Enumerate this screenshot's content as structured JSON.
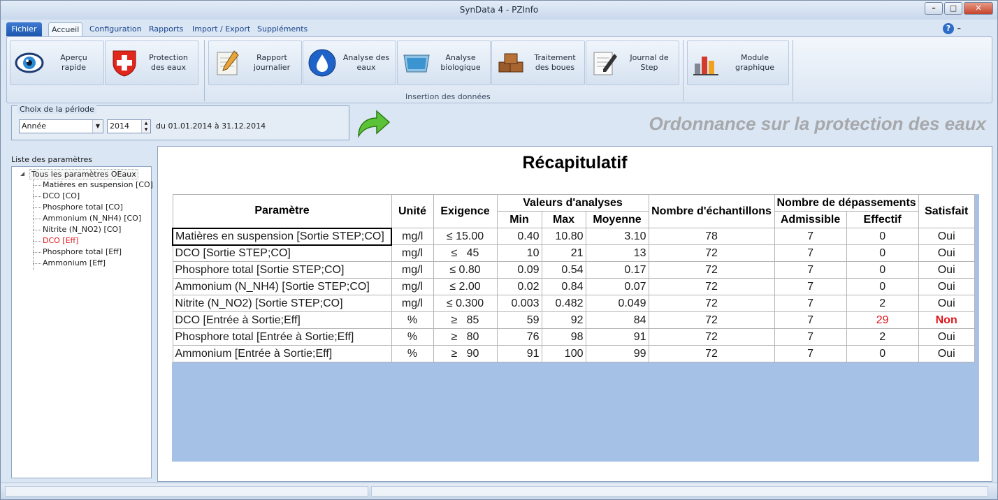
{
  "window": {
    "title": "SynData 4 - PZInfo"
  },
  "tabs": {
    "fichier": "Fichier",
    "accueil": "Accueil",
    "configuration": "Configuration",
    "rapports": "Rapports",
    "import_export": "Import / Export",
    "supplements": "Suppléments"
  },
  "help_label": "?",
  "ribbon": {
    "apercu": "Aperçu rapide",
    "protection": "Protection des eaux",
    "rapport": "Rapport journalier",
    "analyse_eaux": "Analyse des eaux",
    "analyse_bio": "Analyse biologique",
    "traitement": "Traitement des boues",
    "journal": "Journal de Step",
    "module": "Module graphique",
    "group_insertion": "Insertion des données"
  },
  "period": {
    "legend": "Choix de la période",
    "type": "Année",
    "year": "2014",
    "range": "du 01.01.2014 à 31.12.2014"
  },
  "banner": "Ordonnance sur la protection des eaux",
  "sidebar": {
    "title": "Liste des paramètres",
    "root": "Tous les paramètres OEaux",
    "items": [
      "Matières en suspension [CO]",
      "DCO [CO]",
      "Phosphore total [CO]",
      "Ammonium (N_NH4) [CO]",
      "Nitrite (N_NO2) [CO]",
      "DCO [Eff]",
      "Phosphore total [Eff]",
      "Ammonium [Eff]"
    ]
  },
  "recap": {
    "title": "Récapitulatif",
    "headers": {
      "parametre": "Paramètre",
      "unite": "Unité",
      "exigence": "Exigence",
      "valeurs": "Valeurs d'analyses",
      "min": "Min",
      "max": "Max",
      "moyenne": "Moyenne",
      "nb_echantillons": "Nombre d'échantillons",
      "nb_depassements": "Nombre de dépassements",
      "admissible": "Admissible",
      "effectif": "Effectif",
      "satisfait": "Satisfait"
    },
    "rows": [
      {
        "param": "Matières en suspension [Sortie STEP;CO]",
        "unite": "mg/l",
        "exigence": "≤ 15.00",
        "min": "0.40",
        "max": "10.80",
        "moyenne": "3.10",
        "echantillons": "78",
        "admissible": "7",
        "effectif": "0",
        "satisfait": "Oui"
      },
      {
        "param": "DCO [Sortie STEP;CO]",
        "unite": "mg/l",
        "exigence": "≤   45",
        "min": "10",
        "max": "21",
        "moyenne": "13",
        "echantillons": "72",
        "admissible": "7",
        "effectif": "0",
        "satisfait": "Oui"
      },
      {
        "param": "Phosphore total [Sortie STEP;CO]",
        "unite": "mg/l",
        "exigence": "≤ 0.80",
        "min": "0.09",
        "max": "0.54",
        "moyenne": "0.17",
        "echantillons": "72",
        "admissible": "7",
        "effectif": "0",
        "satisfait": "Oui"
      },
      {
        "param": "Ammonium (N_NH4) [Sortie STEP;CO]",
        "unite": "mg/l",
        "exigence": "≤ 2.00",
        "min": "0.02",
        "max": "0.84",
        "moyenne": "0.07",
        "echantillons": "72",
        "admissible": "7",
        "effectif": "0",
        "satisfait": "Oui"
      },
      {
        "param": "Nitrite (N_NO2) [Sortie STEP;CO]",
        "unite": "mg/l",
        "exigence": "≤ 0.300",
        "min": "0.003",
        "max": "0.482",
        "moyenne": "0.049",
        "echantillons": "72",
        "admissible": "7",
        "effectif": "2",
        "satisfait": "Oui"
      },
      {
        "param": "DCO [Entrée à Sortie;Eff]",
        "unite": "%",
        "exigence": "≥   85",
        "min": "59",
        "max": "92",
        "moyenne": "84",
        "echantillons": "72",
        "admissible": "7",
        "effectif": "29",
        "satisfait": "Non"
      },
      {
        "param": "Phosphore total [Entrée à Sortie;Eff]",
        "unite": "%",
        "exigence": "≥   80",
        "min": "76",
        "max": "98",
        "moyenne": "91",
        "echantillons": "72",
        "admissible": "7",
        "effectif": "2",
        "satisfait": "Oui"
      },
      {
        "param": "Ammonium [Entrée à Sortie;Eff]",
        "unite": "%",
        "exigence": "≥   90",
        "min": "91",
        "max": "100",
        "moyenne": "99",
        "echantillons": "72",
        "admissible": "7",
        "effectif": "0",
        "satisfait": "Oui"
      }
    ]
  },
  "colors": {
    "accent": "#1c56ad",
    "failure": "#e0141b",
    "table_bg": "#a5c2e6"
  }
}
